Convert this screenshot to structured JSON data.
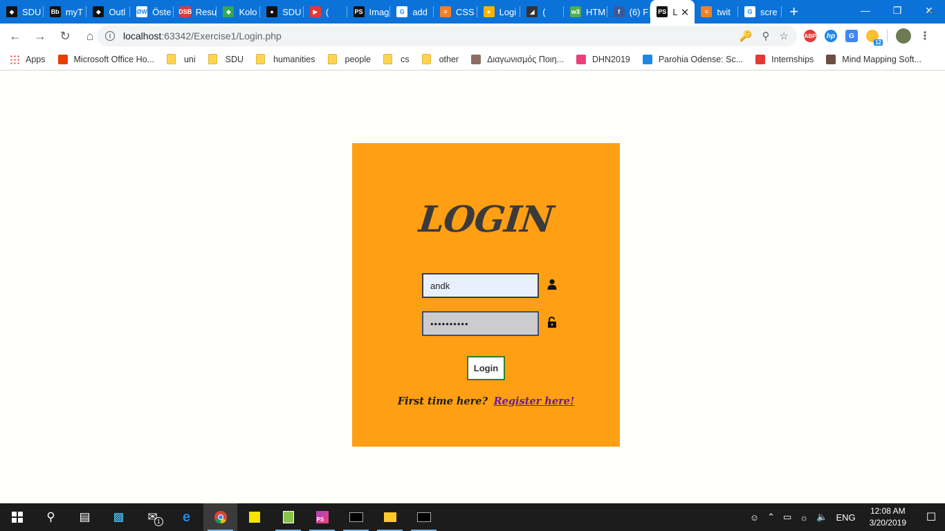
{
  "browser": {
    "tabs": [
      {
        "label": "SDU",
        "fav_color": "#111111",
        "fav_text": "◆"
      },
      {
        "label": "myT",
        "fav_color": "#111111",
        "fav_text": "Bb"
      },
      {
        "label": "Outl",
        "fav_color": "#111111",
        "fav_text": "◆"
      },
      {
        "label": "Öste",
        "fav_color": "#ffffff",
        "fav_text": "ØW"
      },
      {
        "label": "Resu",
        "fav_color": "#e53935",
        "fav_text": "DSB"
      },
      {
        "label": "Kolo",
        "fav_color": "#34a853",
        "fav_text": "◆"
      },
      {
        "label": "SDU",
        "fav_color": "#111111",
        "fav_text": "●"
      },
      {
        "label": "(",
        "fav_color": "#e53935",
        "fav_text": "▶"
      },
      {
        "label": "Imag",
        "fav_color": "#111111",
        "fav_text": "PS"
      },
      {
        "label": "add",
        "fav_color": "#ffffff",
        "fav_text": "G"
      },
      {
        "label": "CSS",
        "fav_color": "#f48024",
        "fav_text": "≡"
      },
      {
        "label": "Logi",
        "fav_color": "#ffb300",
        "fav_text": "●"
      },
      {
        "label": "(",
        "fav_color": "#333333",
        "fav_text": "◢"
      },
      {
        "label": "HTM",
        "fav_color": "#4caf50",
        "fav_text": "w3"
      },
      {
        "label": "(6) F",
        "fav_color": "#3b5998",
        "fav_text": "f"
      }
    ],
    "active_tab": {
      "label": "L",
      "fav_color": "#111111",
      "fav_text": "PS"
    },
    "tabs_after": [
      {
        "label": "twit",
        "fav_color": "#f48024",
        "fav_text": "≡"
      },
      {
        "label": "scre",
        "fav_color": "#ffffff",
        "fav_text": "G"
      }
    ],
    "new_tab_label": "+",
    "url_host": "localhost",
    "url_rest": ":63342/Exercise1/Login.php",
    "bookmarks": [
      {
        "label": "Apps",
        "type": "apps"
      },
      {
        "label": "Microsoft Office Ho...",
        "type": "office"
      },
      {
        "label": "uni",
        "type": "folder"
      },
      {
        "label": "SDU",
        "type": "folder"
      },
      {
        "label": "humanities",
        "type": "folder"
      },
      {
        "label": "people",
        "type": "folder"
      },
      {
        "label": "cs",
        "type": "folder"
      },
      {
        "label": "other",
        "type": "folder"
      },
      {
        "label": "Διαγωνισμός Ποιη...",
        "type": "site"
      },
      {
        "label": "DHN2019",
        "type": "site"
      },
      {
        "label": "Parohia Odense: Sc...",
        "type": "site"
      },
      {
        "label": "Internships",
        "type": "site"
      },
      {
        "label": "Mind Mapping Soft...",
        "type": "site"
      }
    ],
    "ext_badge": "12"
  },
  "login": {
    "title": "LOGIN",
    "username_value": "andk",
    "password_value": "••••••••••",
    "button_label": "Login",
    "register_prompt": "First time here?",
    "register_link": "Register here!",
    "accent": "#fe9f14"
  },
  "taskbar": {
    "language": "ENG",
    "time": "12:08 AM",
    "date": "3/20/2019",
    "mail_badge": "1"
  }
}
